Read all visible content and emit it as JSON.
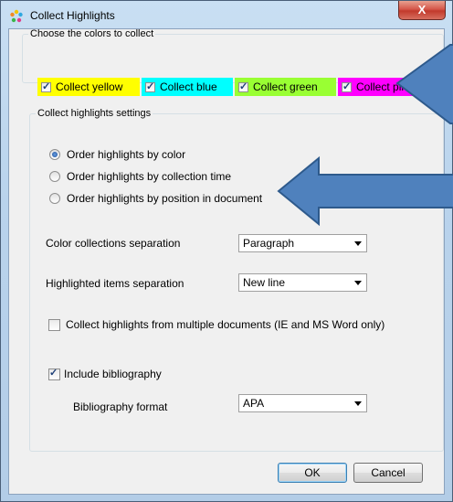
{
  "window": {
    "title": "Collect Highlights",
    "close_glyph": "X"
  },
  "colors_group": {
    "legend": "Choose the colors to collect",
    "items": [
      {
        "label": "Collect yellow",
        "checked": true,
        "bg": "#ffff00"
      },
      {
        "label": "Collect blue",
        "checked": true,
        "bg": "#00ffff"
      },
      {
        "label": "Collect green",
        "checked": true,
        "bg": "#99ff33"
      },
      {
        "label": "Collect pink",
        "checked": true,
        "bg": "#ff00ff"
      }
    ]
  },
  "settings_group": {
    "legend": "Collect highlights settings",
    "order_options": [
      {
        "label": "Order highlights by color",
        "selected": true
      },
      {
        "label": "Order highlights by collection time",
        "selected": false
      },
      {
        "label": "Order highlights by position in document",
        "selected": false
      }
    ],
    "color_sep_label": "Color collections separation",
    "color_sep_value": "Paragraph",
    "item_sep_label": "Highlighted items separation",
    "item_sep_value": "New line",
    "multi_docs_label": "Collect highlights from multiple documents (IE and MS Word only)",
    "multi_docs_checked": false,
    "biblio_label": "Include bibliography",
    "biblio_checked": true,
    "biblio_format_label": "Bibliography format",
    "biblio_format_value": "APA"
  },
  "buttons": {
    "ok": "OK",
    "cancel": "Cancel"
  },
  "annotation_colors": {
    "arrow_fill": "#4f81bd",
    "arrow_stroke": "#2e5a8c"
  }
}
